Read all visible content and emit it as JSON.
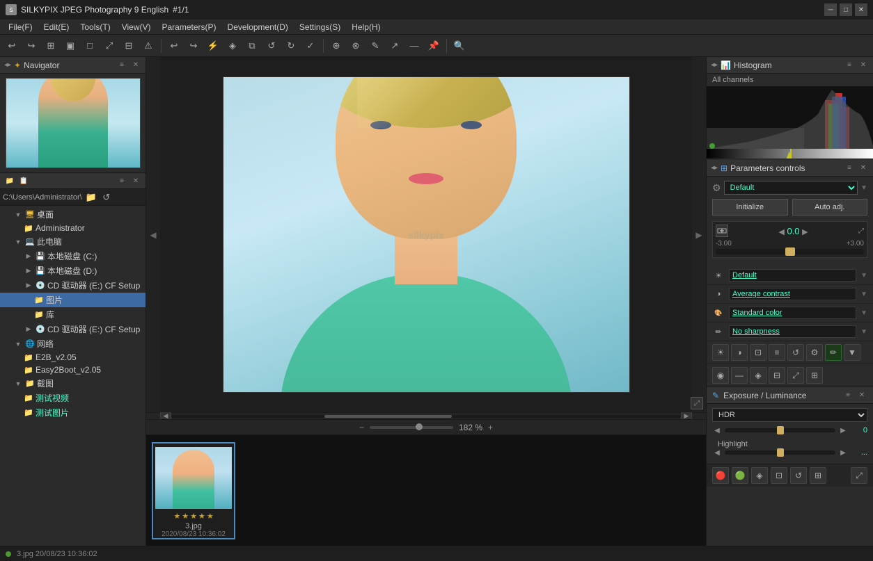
{
  "titlebar": {
    "logo": "S",
    "title": "SILKYPIX JPEG Photography 9 English",
    "file_counter": "#1/1",
    "min_btn": "─",
    "max_btn": "□",
    "close_btn": "✕"
  },
  "menubar": {
    "items": [
      {
        "label": "File(F)"
      },
      {
        "label": "Edit(E)"
      },
      {
        "label": "Tools(T)"
      },
      {
        "label": "View(V)"
      },
      {
        "label": "Parameters(P)"
      },
      {
        "label": "Development(D)"
      },
      {
        "label": "Settings(S)"
      },
      {
        "label": "Help(H)"
      }
    ]
  },
  "navigator": {
    "title": "Navigator",
    "collapse_icon": "◁▶",
    "close_icon": "✕"
  },
  "file_browser": {
    "path": "C:\\Users\\Administrator\\",
    "tree": [
      {
        "label": "桌面",
        "indent": 1,
        "type": "folder",
        "expanded": true
      },
      {
        "label": "Administrator",
        "indent": 2,
        "type": "folder"
      },
      {
        "label": "此电脑",
        "indent": 1,
        "type": "computer",
        "expanded": true
      },
      {
        "label": "本地磁盘 (C:)",
        "indent": 2,
        "type": "drive"
      },
      {
        "label": "本地磁盘 (D:)",
        "indent": 2,
        "type": "drive"
      },
      {
        "label": "CD 驱动器 (E:) CF Setup",
        "indent": 2,
        "type": "drive"
      },
      {
        "label": "图片",
        "indent": 3,
        "type": "folder",
        "selected": true
      },
      {
        "label": "库",
        "indent": 3,
        "type": "folder"
      },
      {
        "label": "CD 驱动器 (E:) CF Setup",
        "indent": 2,
        "type": "drive"
      },
      {
        "label": "网络",
        "indent": 1,
        "type": "network",
        "expanded": true
      },
      {
        "label": "E2B_v2.05",
        "indent": 2,
        "type": "folder"
      },
      {
        "label": "Easy2Boot_v2.05",
        "indent": 2,
        "type": "folder"
      },
      {
        "label": "截图",
        "indent": 1,
        "type": "folder",
        "expanded": true
      },
      {
        "label": "测试视频",
        "indent": 2,
        "type": "folder",
        "highlighted": true
      },
      {
        "label": "测试图片",
        "indent": 2,
        "type": "folder",
        "highlighted": true
      }
    ]
  },
  "histogram": {
    "title": "Histogram",
    "channel_label": "All channels"
  },
  "parameters": {
    "title": "Parameters controls",
    "preset_label": "Default",
    "init_btn": "Initialize",
    "auto_btn": "Auto adj.",
    "ev_value": "0.0",
    "ev_min": "-3.00",
    "ev_max": "+3.00",
    "rows": [
      {
        "icon": "☀",
        "value": "Default"
      },
      {
        "icon": "◑",
        "value": "Average contrast"
      },
      {
        "icon": "⬛",
        "value": "Standard color"
      },
      {
        "icon": "✏",
        "value": "No sharpness"
      }
    ]
  },
  "tools_icons": [
    "✂",
    "▼",
    "▲",
    "≡",
    "↺",
    "⚙",
    "✏",
    "▼",
    "◉",
    "—",
    "↕",
    "⤢",
    "↺",
    "⊞"
  ],
  "exposure": {
    "title": "Exposure / Luminance",
    "hdr_label": "HDR",
    "hdr_value": "0",
    "highlight_label": "Highlight",
    "highlight_value": "0"
  },
  "filmstrip": {
    "items": [
      {
        "name": "3.jpg",
        "date": "2020/08/23 10:36:02",
        "stars": [
          true,
          true,
          true,
          true,
          true
        ],
        "active": true
      }
    ]
  },
  "status_bar": {
    "info": "3.jpg 20/08/23 10:36:02"
  },
  "zoom": {
    "level": "182 %"
  }
}
